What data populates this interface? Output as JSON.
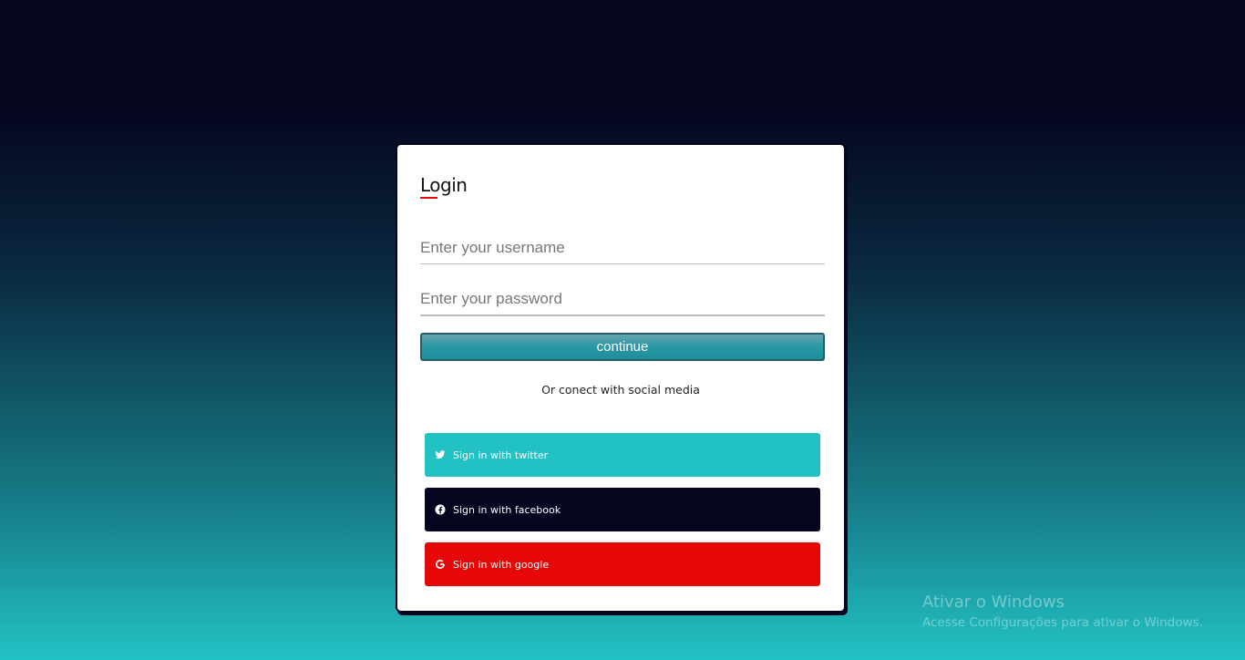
{
  "login": {
    "title": "Login",
    "username_placeholder": "Enter your username",
    "password_placeholder": "Enter your password",
    "continue_label": "continue",
    "social_caption": "Or conect with social media"
  },
  "social": {
    "twitter_label": "Sign in with twitter",
    "facebook_label": "Sign in with facebook",
    "google_label": "Sign in with google"
  },
  "colors": {
    "background_top": "#050520",
    "background_bottom": "#22c2c4",
    "accent_red": "#e60808",
    "twitter": "#22c2c4",
    "facebook": "#050520",
    "google": "#e60808"
  },
  "icons": {
    "twitter": "twitter-icon",
    "facebook": "facebook-icon",
    "google": "google-icon"
  },
  "watermark": {
    "title": "Ativar o Windows",
    "subtitle": "Acesse Configurações para ativar o Windows."
  }
}
